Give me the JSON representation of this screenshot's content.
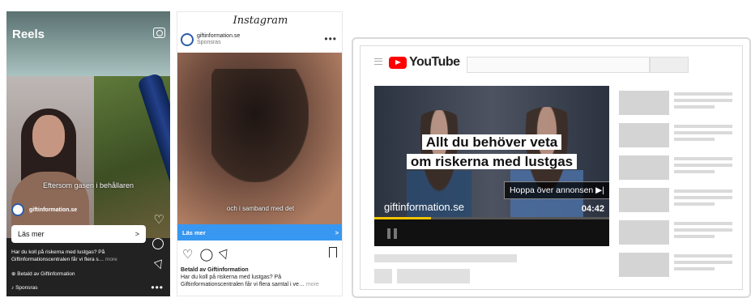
{
  "reels": {
    "title": "Reels",
    "caption": "Eftersom gasen i behållaren",
    "account": "giftinformation.se",
    "cta_label": "Läs mer",
    "cta_chevron": ">",
    "description": "Har du koll på riskerna med lustgas? På Giftinformationscentralen får vi flera s…",
    "more": "more",
    "paid_by": "Betald av Giftinformation",
    "sponsored": "Sponsras",
    "icons": [
      "camera-icon",
      "heart-icon",
      "comment-icon",
      "send-icon",
      "more-icon"
    ]
  },
  "instagram": {
    "logo": "Instagram",
    "account": "giftinformation.se",
    "sponsored": "Sponsras",
    "menu": "•••",
    "subtitle": "och i samband med det",
    "cta_label": "Läs mer",
    "cta_chevron": ">",
    "actions": [
      "heart-icon",
      "comment-icon",
      "send-icon",
      "bookmark-icon"
    ],
    "paid_by": "Betald av Giftinformation",
    "description": "Har du koll på riskerna med lustgas? På Giftinformationscentralen får vi flera samtal i ve…",
    "more": "more"
  },
  "youtube": {
    "logo_text": "YouTube",
    "headline_line1": "Allt du behöver veta",
    "headline_line2": "om riskerna med lustgas",
    "skip_label": "Hoppa över annonsen ▶|",
    "brand": "giftinformation.se",
    "time": "04:42",
    "progress": 0.24,
    "accent": "#ff0000",
    "progress_color": "#f5c400"
  }
}
